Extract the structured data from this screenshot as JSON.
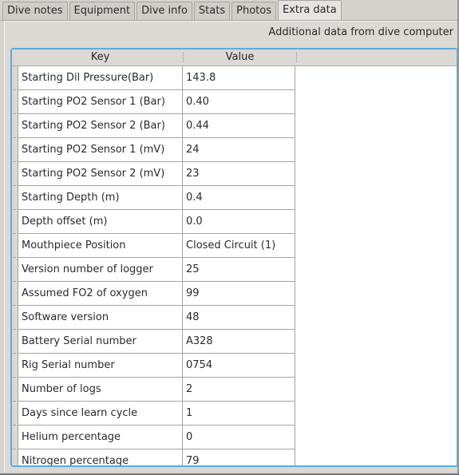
{
  "tabs": [
    {
      "label": "Dive notes",
      "active": false
    },
    {
      "label": "Equipment",
      "active": false
    },
    {
      "label": "Dive info",
      "active": false
    },
    {
      "label": "Stats",
      "active": false
    },
    {
      "label": "Photos",
      "active": false
    },
    {
      "label": "Extra data",
      "active": true
    }
  ],
  "extra_data": {
    "description": "Additional data from dive computer",
    "columns": {
      "key": "Key",
      "value": "Value"
    },
    "rows": [
      {
        "key": "Starting Dil Pressure(Bar)",
        "value": "143.8"
      },
      {
        "key": "Starting PO2 Sensor 1 (Bar)",
        "value": "0.40"
      },
      {
        "key": "Starting PO2 Sensor 2 (Bar)",
        "value": "0.44"
      },
      {
        "key": "Starting PO2 Sensor 1 (mV)",
        "value": "24"
      },
      {
        "key": "Starting PO2 Sensor 2 (mV)",
        "value": "23"
      },
      {
        "key": "Starting Depth (m)",
        "value": "0.4"
      },
      {
        "key": "Depth offset (m)",
        "value": "0.0"
      },
      {
        "key": "Mouthpiece Position",
        "value": "Closed Circuit (1)"
      },
      {
        "key": "Version number of logger",
        "value": "25"
      },
      {
        "key": "Assumed FO2 of oxygen",
        "value": "99"
      },
      {
        "key": "Software version",
        "value": "48"
      },
      {
        "key": "Battery Serial number",
        "value": "A328"
      },
      {
        "key": "Rig Serial number",
        "value": "0754"
      },
      {
        "key": "Number of logs",
        "value": "2"
      },
      {
        "key": "Days since learn cycle",
        "value": "1"
      },
      {
        "key": "Helium percentage",
        "value": "0"
      },
      {
        "key": "Nitrogen percentage",
        "value": "79"
      }
    ]
  }
}
